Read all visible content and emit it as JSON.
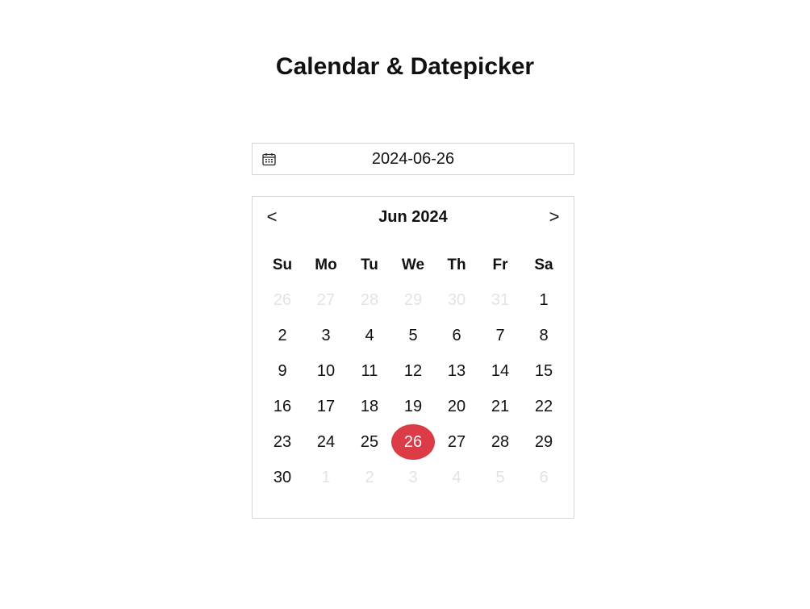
{
  "page": {
    "title": "Calendar & Datepicker"
  },
  "date_field": {
    "icon": "calendar-icon",
    "value": "2024-06-26"
  },
  "calendar": {
    "prev_label": "<",
    "next_label": ">",
    "month_label": "Jun 2024",
    "weekdays": [
      "Su",
      "Mo",
      "Tu",
      "We",
      "Th",
      "Fr",
      "Sa"
    ],
    "days": [
      {
        "label": "26",
        "outside": true
      },
      {
        "label": "27",
        "outside": true
      },
      {
        "label": "28",
        "outside": true
      },
      {
        "label": "29",
        "outside": true
      },
      {
        "label": "30",
        "outside": true
      },
      {
        "label": "31",
        "outside": true
      },
      {
        "label": "1"
      },
      {
        "label": "2"
      },
      {
        "label": "3"
      },
      {
        "label": "4"
      },
      {
        "label": "5"
      },
      {
        "label": "6"
      },
      {
        "label": "7"
      },
      {
        "label": "8"
      },
      {
        "label": "9"
      },
      {
        "label": "10"
      },
      {
        "label": "11"
      },
      {
        "label": "12"
      },
      {
        "label": "13"
      },
      {
        "label": "14"
      },
      {
        "label": "15"
      },
      {
        "label": "16"
      },
      {
        "label": "17"
      },
      {
        "label": "18"
      },
      {
        "label": "19"
      },
      {
        "label": "20"
      },
      {
        "label": "21"
      },
      {
        "label": "22"
      },
      {
        "label": "23"
      },
      {
        "label": "24"
      },
      {
        "label": "25"
      },
      {
        "label": "26",
        "selected": true
      },
      {
        "label": "27"
      },
      {
        "label": "28"
      },
      {
        "label": "29"
      },
      {
        "label": "30"
      },
      {
        "label": "1",
        "outside": true
      },
      {
        "label": "2",
        "outside": true
      },
      {
        "label": "3",
        "outside": true
      },
      {
        "label": "4",
        "outside": true
      },
      {
        "label": "5",
        "outside": true
      },
      {
        "label": "6",
        "outside": true
      }
    ]
  },
  "colors": {
    "selected_bg": "#dc3c47",
    "selected_text": "#ffffff",
    "muted_text": "#e3e3e3",
    "border": "#d6d6d6"
  }
}
